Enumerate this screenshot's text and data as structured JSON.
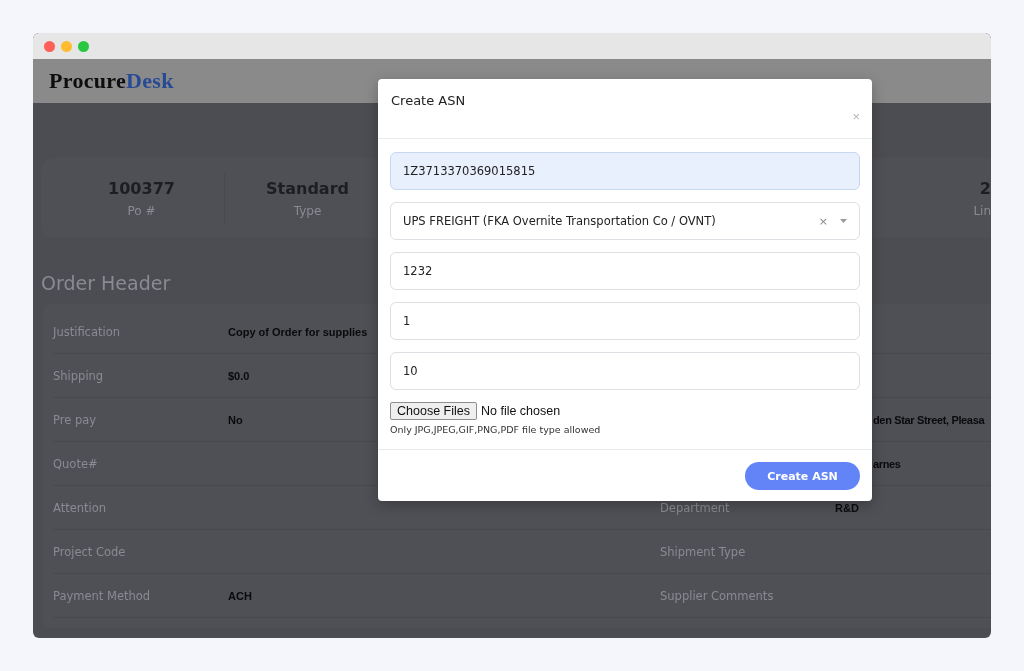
{
  "logo": {
    "first": "Procure",
    "second": "Desk"
  },
  "stats": [
    {
      "value": "100377",
      "label": "Po #"
    },
    {
      "value": "Standard",
      "label": "Type"
    },
    {
      "value": "2",
      "label": "Lin"
    }
  ],
  "section_title": "Order Header",
  "rows": [
    {
      "cells": [
        {
          "label": "Justification",
          "value": "Copy of Order for supplies"
        }
      ]
    },
    {
      "cells": [
        {
          "label": "Shipping",
          "value": "$0.0"
        }
      ]
    },
    {
      "cells": [
        {
          "label": "Pre pay",
          "value": "No"
        },
        {
          "value": "den Star Street, Pleasa"
        }
      ]
    },
    {
      "cells": [
        {
          "label": "Quote#"
        },
        {
          "value": "arnes"
        }
      ]
    },
    {
      "cells": [
        {
          "label": "Attention"
        },
        {
          "label": "Department",
          "value": "R&D"
        }
      ]
    },
    {
      "cells": [
        {
          "label": "Project Code"
        },
        {
          "label": "Shipment Type"
        }
      ]
    },
    {
      "cells": [
        {
          "label": "Payment Method",
          "value": "ACH"
        },
        {
          "label": "Supplier Comments"
        }
      ]
    }
  ],
  "modal": {
    "title": "Create ASN",
    "close": "×",
    "fields": [
      {
        "kind": "text",
        "value": "1Z3713370369015815",
        "autofilled": true
      },
      {
        "kind": "select",
        "value": "UPS FREIGHT (FKA Overnite Transportation Co / OVNT)",
        "clear": "×"
      },
      {
        "kind": "text",
        "value": "1232",
        "autofilled": false
      },
      {
        "kind": "text",
        "value": "1",
        "autofilled": false
      },
      {
        "kind": "text",
        "value": "10",
        "autofilled": false
      }
    ],
    "file": {
      "button": "Choose Files",
      "status": "No file chosen",
      "hint": "Only JPG,JPEG,GIF,PNG,PDF file type allowed"
    },
    "submit": "Create ASN"
  }
}
